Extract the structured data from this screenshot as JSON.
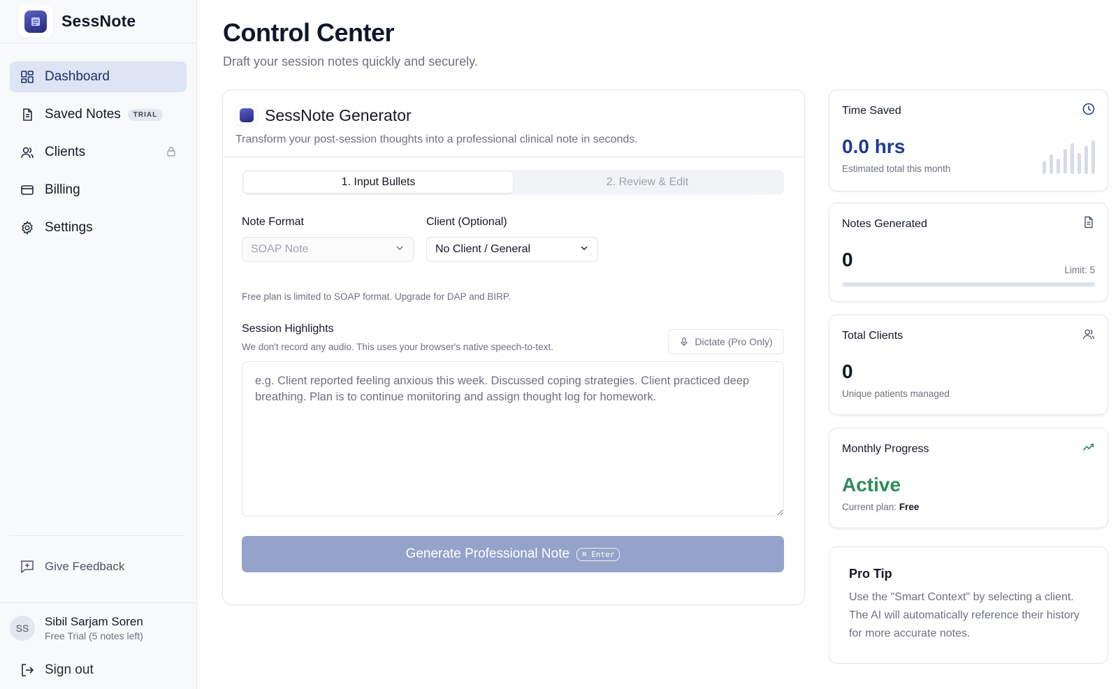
{
  "brand": {
    "name": "SessNote"
  },
  "sidebar": {
    "items": [
      {
        "label": "Dashboard",
        "icon": "dashboard-icon",
        "active": true
      },
      {
        "label": "Saved Notes",
        "icon": "document-icon",
        "badge": "TRIAL"
      },
      {
        "label": "Clients",
        "icon": "users-icon",
        "locked": true
      },
      {
        "label": "Billing",
        "icon": "credit-card-icon"
      },
      {
        "label": "Settings",
        "icon": "gear-icon"
      }
    ],
    "feedback_label": "Give Feedback",
    "user": {
      "initials": "SS",
      "name": "Sibil Sarjam Soren",
      "plan": "Free Trial (5 notes left)"
    },
    "signout_label": "Sign out"
  },
  "header": {
    "title": "Control Center",
    "subtitle": "Draft your session notes quickly and securely."
  },
  "generator": {
    "title": "SessNote Generator",
    "description": "Transform your post-session thoughts into a professional clinical note in seconds.",
    "tabs": [
      {
        "label": "1. Input Bullets",
        "active": true
      },
      {
        "label": "2. Review & Edit",
        "active": false
      }
    ],
    "note_format": {
      "label": "Note Format",
      "value": "SOAP Note",
      "disabled": true
    },
    "client": {
      "label": "Client (Optional)",
      "value": "No Client / General"
    },
    "format_hint": "Free plan is limited to SOAP format. Upgrade for DAP and BIRP.",
    "highlights": {
      "label": "Session Highlights",
      "hint": "We don't record any audio. This uses your browser's native speech-to-text.",
      "dictate_label": "Dictate (Pro Only)",
      "placeholder": "e.g. Client reported feeling anxious this week. Discussed coping strategies. Client practiced deep breathing. Plan is to continue monitoring and assign thought log for homework."
    },
    "generate_label": "Generate Professional Note",
    "shortcut": "⌘ Enter"
  },
  "stats": {
    "time_saved": {
      "title": "Time Saved",
      "value": "0.0 hrs",
      "sub": "Estimated total this month",
      "icon": "clock-icon"
    },
    "notes_generated": {
      "title": "Notes Generated",
      "value": "0",
      "limit": "Limit: 5",
      "progress": 0,
      "icon": "document-icon"
    },
    "total_clients": {
      "title": "Total Clients",
      "value": "0",
      "sub": "Unique patients managed",
      "icon": "users-icon"
    },
    "monthly_progress": {
      "title": "Monthly Progress",
      "value": "Active",
      "sub_prefix": "Current plan:",
      "plan": "Free",
      "icon": "trending-up-icon"
    }
  },
  "pro_tip": {
    "title": "Pro Tip",
    "text": "Use the \"Smart Context\" by selecting a client. The AI will automatically reference their history for more accurate notes."
  },
  "colors": {
    "accent": "#1f3a93",
    "active_nav_bg": "#dde5f4",
    "success": "#2e8b57",
    "button": "#94a3c9"
  }
}
